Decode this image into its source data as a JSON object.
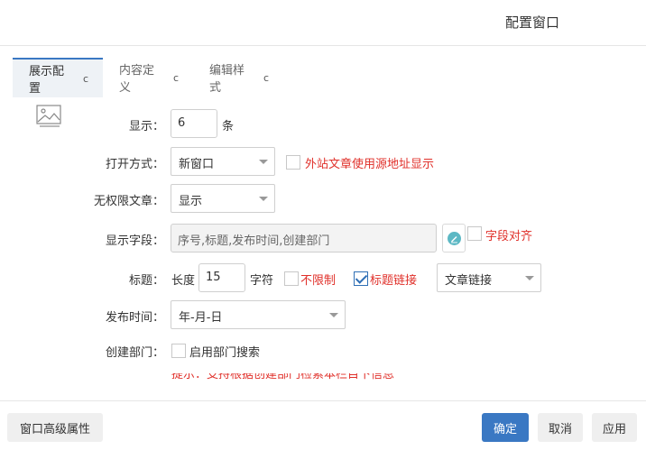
{
  "dialog": {
    "title": "配置窗口"
  },
  "tabs": [
    {
      "label": "展示配置",
      "active": true
    },
    {
      "label": "内容定义",
      "active": false
    },
    {
      "label": "编辑样式",
      "active": false
    }
  ],
  "tab_refresh_glyph": "c",
  "form": {
    "display": {
      "label": "显示：",
      "value": "6",
      "unit": "条"
    },
    "open_mode": {
      "label": "打开方式：",
      "selected": "新窗口",
      "option_label": "外站文章使用源地址显示",
      "option_checked": false
    },
    "no_permission": {
      "label": "无权限文章：",
      "selected": "显示"
    },
    "display_fields": {
      "label": "显示字段：",
      "placeholder": "序号,标题,发布时间,创建部门",
      "align_label": "字段对齐",
      "align_checked": false
    },
    "title": {
      "label": "标题：",
      "length_label": "长度",
      "length_value": "15",
      "char_label": "字符",
      "unlimited_label": "不限制",
      "unlimited_checked": false,
      "link_label": "标题链接",
      "link_checked": true,
      "link_type_selected": "文章链接"
    },
    "publish_time": {
      "label": "发布时间：",
      "selected": "年-月-日"
    },
    "creator_dept": {
      "label": "创建部门：",
      "option_label": "启用部门搜索",
      "option_checked": false
    },
    "hint": "提示：支持根据创建部门检索本栏目下信息"
  },
  "footer": {
    "advanced": "窗口高级属性",
    "ok": "确定",
    "cancel": "取消",
    "apply": "应用"
  },
  "colors": {
    "accent": "#3a78c3",
    "warning_text": "#e0302a",
    "edit_icon": "#5cb8c4"
  }
}
